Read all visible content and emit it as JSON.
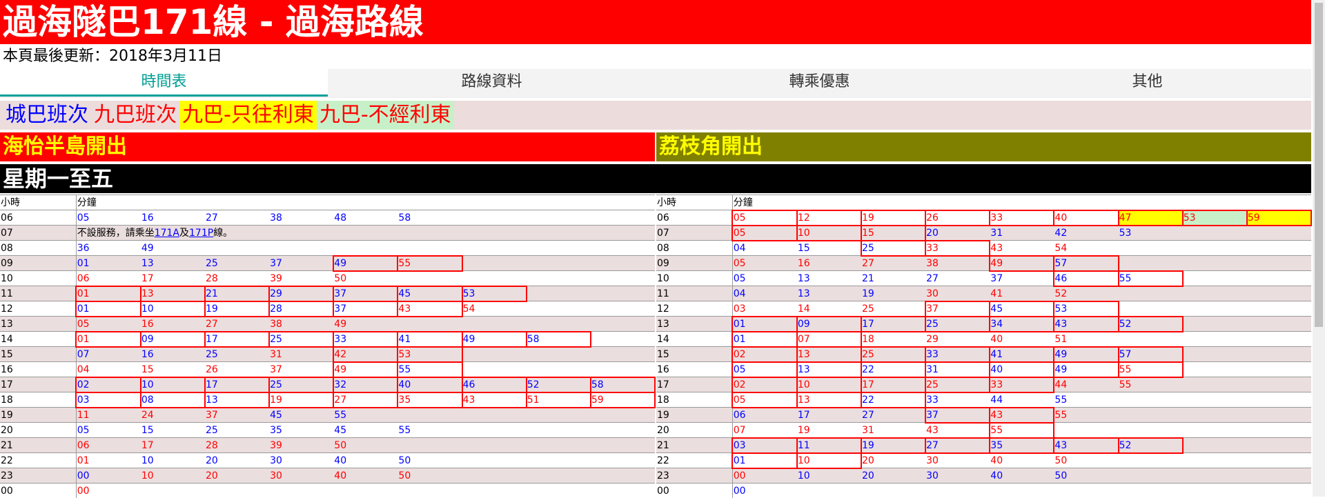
{
  "title": "過海隧巴171線 - 過海路線",
  "updated": "本頁最後更新：2018年3月11日",
  "tabs": [
    {
      "label": "時間表",
      "active": true
    },
    {
      "label": "路線資料",
      "active": false
    },
    {
      "label": "轉乘優惠",
      "active": false
    },
    {
      "label": "其他",
      "active": false
    }
  ],
  "legend": [
    {
      "label": "城巴班次",
      "color": "#0000ff",
      "bg": "#ecdcdc"
    },
    {
      "label": "九巴班次",
      "color": "#ff0000",
      "bg": "#ecdcdc"
    },
    {
      "label": "九巴-只往利東",
      "color": "#ff0000",
      "bg": "#ffff00"
    },
    {
      "label": "九巴-不經利東",
      "color": "#ff0000",
      "bg": "#c8f0c8"
    }
  ],
  "directions": {
    "left": "海怡半島開出",
    "right": "荔枝角開出"
  },
  "day_label": "星期一至五",
  "col_headers": {
    "hour": "小時",
    "minute": "分鐘"
  },
  "left_table": [
    {
      "h": "06",
      "m": [
        [
          "05",
          "c"
        ],
        [
          "16",
          "c"
        ],
        [
          "27",
          "c"
        ],
        [
          "38",
          "c"
        ],
        [
          "48",
          "c"
        ],
        [
          "58",
          "c"
        ]
      ]
    },
    {
      "h": "07",
      "note": {
        "pre": "不設服務，請乘坐",
        "link1": "171A",
        "mid": "及",
        "link2": "171P",
        "post": "線。"
      }
    },
    {
      "h": "08",
      "m": [
        [
          "36",
          "c"
        ],
        [
          "49",
          "c"
        ]
      ]
    },
    {
      "h": "09",
      "m": [
        [
          "01",
          "c"
        ],
        [
          "13",
          "c"
        ],
        [
          "25",
          "c"
        ],
        [
          "37",
          "c"
        ],
        [
          "49",
          "c",
          "box"
        ],
        [
          "55",
          "k",
          "box"
        ]
      ]
    },
    {
      "h": "10",
      "m": [
        [
          "06",
          "k"
        ],
        [
          "17",
          "k"
        ],
        [
          "28",
          "k"
        ],
        [
          "39",
          "k"
        ],
        [
          "50",
          "k"
        ]
      ]
    },
    {
      "h": "11",
      "m": [
        [
          "01",
          "k",
          "box"
        ],
        [
          "13",
          "k",
          "box"
        ],
        [
          "21",
          "c",
          "box"
        ],
        [
          "29",
          "c",
          "box"
        ],
        [
          "37",
          "c",
          "box"
        ],
        [
          "45",
          "c",
          "box"
        ],
        [
          "53",
          "c",
          "box"
        ]
      ]
    },
    {
      "h": "12",
      "m": [
        [
          "01",
          "c",
          "box"
        ],
        [
          "10",
          "c",
          "box"
        ],
        [
          "19",
          "c",
          "box"
        ],
        [
          "28",
          "c",
          "box"
        ],
        [
          "37",
          "c",
          "box"
        ],
        [
          "43",
          "k",
          "box"
        ],
        [
          "54",
          "k"
        ]
      ]
    },
    {
      "h": "13",
      "m": [
        [
          "05",
          "k"
        ],
        [
          "16",
          "k"
        ],
        [
          "27",
          "k"
        ],
        [
          "38",
          "k"
        ],
        [
          "49",
          "k"
        ]
      ]
    },
    {
      "h": "14",
      "m": [
        [
          "01",
          "k",
          "box"
        ],
        [
          "09",
          "c",
          "box"
        ],
        [
          "17",
          "c",
          "box"
        ],
        [
          "25",
          "c",
          "box"
        ],
        [
          "33",
          "c",
          "box"
        ],
        [
          "41",
          "c",
          "box"
        ],
        [
          "49",
          "c",
          "box"
        ],
        [
          "58",
          "c",
          "box"
        ]
      ]
    },
    {
      "h": "15",
      "m": [
        [
          "07",
          "c"
        ],
        [
          "16",
          "c"
        ],
        [
          "25",
          "c"
        ],
        [
          "31",
          "k"
        ],
        [
          "42",
          "k",
          "box"
        ],
        [
          "53",
          "k",
          "box"
        ]
      ]
    },
    {
      "h": "16",
      "m": [
        [
          "04",
          "k"
        ],
        [
          "15",
          "k"
        ],
        [
          "26",
          "k"
        ],
        [
          "37",
          "k"
        ],
        [
          "49",
          "k",
          "box"
        ],
        [
          "55",
          "c",
          "box"
        ]
      ]
    },
    {
      "h": "17",
      "m": [
        [
          "02",
          "c",
          "box"
        ],
        [
          "10",
          "c",
          "box"
        ],
        [
          "17",
          "c",
          "box"
        ],
        [
          "25",
          "c",
          "box"
        ],
        [
          "32",
          "c",
          "box"
        ],
        [
          "40",
          "c",
          "box"
        ],
        [
          "46",
          "c",
          "box"
        ],
        [
          "52",
          "c",
          "box"
        ],
        [
          "58",
          "c",
          "box"
        ]
      ]
    },
    {
      "h": "18",
      "m": [
        [
          "03",
          "c",
          "box"
        ],
        [
          "08",
          "c",
          "box"
        ],
        [
          "13",
          "c",
          "box"
        ],
        [
          "19",
          "k",
          "box"
        ],
        [
          "27",
          "k",
          "box"
        ],
        [
          "35",
          "k",
          "box"
        ],
        [
          "43",
          "k",
          "box"
        ],
        [
          "51",
          "k",
          "box"
        ],
        [
          "59",
          "k",
          "box"
        ]
      ]
    },
    {
      "h": "19",
      "m": [
        [
          "11",
          "k"
        ],
        [
          "24",
          "k"
        ],
        [
          "37",
          "k"
        ],
        [
          "45",
          "c"
        ],
        [
          "55",
          "c"
        ]
      ]
    },
    {
      "h": "20",
      "m": [
        [
          "05",
          "c"
        ],
        [
          "15",
          "c"
        ],
        [
          "25",
          "c"
        ],
        [
          "35",
          "c"
        ],
        [
          "45",
          "c"
        ],
        [
          "55",
          "c"
        ]
      ]
    },
    {
      "h": "21",
      "m": [
        [
          "06",
          "k"
        ],
        [
          "17",
          "k"
        ],
        [
          "28",
          "k"
        ],
        [
          "39",
          "k"
        ],
        [
          "50",
          "k"
        ]
      ]
    },
    {
      "h": "22",
      "m": [
        [
          "01",
          "k"
        ],
        [
          "10",
          "c"
        ],
        [
          "20",
          "c"
        ],
        [
          "30",
          "c"
        ],
        [
          "40",
          "c"
        ],
        [
          "50",
          "c"
        ]
      ]
    },
    {
      "h": "23",
      "m": [
        [
          "00",
          "c"
        ],
        [
          "10",
          "k"
        ],
        [
          "20",
          "k"
        ],
        [
          "30",
          "k"
        ],
        [
          "40",
          "k"
        ],
        [
          "50",
          "k"
        ]
      ]
    },
    {
      "h": "00",
      "m": [
        [
          "00",
          "k"
        ]
      ]
    }
  ],
  "right_table": [
    {
      "h": "06",
      "m": [
        [
          "05",
          "k",
          "box"
        ],
        [
          "12",
          "k",
          "box"
        ],
        [
          "19",
          "k",
          "box"
        ],
        [
          "26",
          "k",
          "box"
        ],
        [
          "33",
          "k",
          "box"
        ],
        [
          "40",
          "k",
          "box"
        ],
        [
          "47",
          "k",
          "hl-y box"
        ],
        [
          "53",
          "k",
          "hl-g box"
        ],
        [
          "59",
          "k",
          "hl-y box"
        ]
      ]
    },
    {
      "h": "07",
      "m": [
        [
          "05",
          "k",
          "hl-g box"
        ],
        [
          "10",
          "k",
          "hl-y box"
        ],
        [
          "15",
          "k",
          "hl-g box"
        ],
        [
          "20",
          "c"
        ],
        [
          "31",
          "c"
        ],
        [
          "42",
          "c"
        ],
        [
          "53",
          "c"
        ]
      ]
    },
    {
      "h": "08",
      "m": [
        [
          "04",
          "c"
        ],
        [
          "15",
          "c"
        ],
        [
          "25",
          "c",
          "box"
        ],
        [
          "33",
          "k",
          "box"
        ],
        [
          "43",
          "k"
        ],
        [
          "54",
          "k"
        ]
      ]
    },
    {
      "h": "09",
      "m": [
        [
          "05",
          "k"
        ],
        [
          "16",
          "k"
        ],
        [
          "27",
          "k"
        ],
        [
          "38",
          "k"
        ],
        [
          "49",
          "k",
          "box"
        ],
        [
          "57",
          "c",
          "box"
        ]
      ]
    },
    {
      "h": "10",
      "m": [
        [
          "05",
          "c"
        ],
        [
          "13",
          "c"
        ],
        [
          "21",
          "c"
        ],
        [
          "27",
          "c"
        ],
        [
          "37",
          "c"
        ],
        [
          "46",
          "c",
          "box"
        ],
        [
          "55",
          "c",
          "box"
        ]
      ]
    },
    {
      "h": "11",
      "m": [
        [
          "04",
          "c"
        ],
        [
          "13",
          "c"
        ],
        [
          "19",
          "c"
        ],
        [
          "30",
          "k"
        ],
        [
          "41",
          "k"
        ],
        [
          "52",
          "k"
        ]
      ]
    },
    {
      "h": "12",
      "m": [
        [
          "03",
          "k"
        ],
        [
          "14",
          "k"
        ],
        [
          "25",
          "k"
        ],
        [
          "37",
          "k",
          "box"
        ],
        [
          "45",
          "c",
          "box"
        ],
        [
          "53",
          "c",
          "box"
        ]
      ]
    },
    {
      "h": "13",
      "m": [
        [
          "01",
          "c",
          "box"
        ],
        [
          "09",
          "c",
          "box"
        ],
        [
          "17",
          "c",
          "box"
        ],
        [
          "25",
          "c",
          "box"
        ],
        [
          "34",
          "c",
          "box"
        ],
        [
          "43",
          "c",
          "box"
        ],
        [
          "52",
          "c",
          "box"
        ]
      ]
    },
    {
      "h": "14",
      "m": [
        [
          "01",
          "c",
          "box"
        ],
        [
          "07",
          "k",
          "box"
        ],
        [
          "18",
          "k"
        ],
        [
          "29",
          "k"
        ],
        [
          "40",
          "k"
        ],
        [
          "51",
          "k"
        ]
      ]
    },
    {
      "h": "15",
      "m": [
        [
          "02",
          "k",
          "box"
        ],
        [
          "13",
          "k",
          "box"
        ],
        [
          "25",
          "k",
          "box"
        ],
        [
          "33",
          "c",
          "box"
        ],
        [
          "41",
          "c",
          "box"
        ],
        [
          "49",
          "c",
          "box"
        ],
        [
          "57",
          "c",
          "box"
        ]
      ]
    },
    {
      "h": "16",
      "m": [
        [
          "05",
          "c",
          "box"
        ],
        [
          "13",
          "c",
          "box"
        ],
        [
          "22",
          "c",
          "box"
        ],
        [
          "31",
          "c",
          "box"
        ],
        [
          "40",
          "c",
          "box"
        ],
        [
          "49",
          "c",
          "box"
        ],
        [
          "55",
          "k",
          "box"
        ]
      ]
    },
    {
      "h": "17",
      "m": [
        [
          "02",
          "k",
          "box"
        ],
        [
          "10",
          "k",
          "box"
        ],
        [
          "17",
          "k",
          "box"
        ],
        [
          "25",
          "k",
          "box"
        ],
        [
          "33",
          "k",
          "box"
        ],
        [
          "44",
          "k"
        ],
        [
          "55",
          "k"
        ]
      ]
    },
    {
      "h": "18",
      "m": [
        [
          "05",
          "k",
          "box"
        ],
        [
          "13",
          "k",
          "box"
        ],
        [
          "22",
          "c",
          "box"
        ],
        [
          "33",
          "c"
        ],
        [
          "44",
          "c"
        ],
        [
          "55",
          "c"
        ]
      ]
    },
    {
      "h": "19",
      "m": [
        [
          "06",
          "c"
        ],
        [
          "17",
          "c"
        ],
        [
          "27",
          "c"
        ],
        [
          "37",
          "c",
          "box"
        ],
        [
          "43",
          "k",
          "box"
        ],
        [
          "55",
          "k"
        ]
      ]
    },
    {
      "h": "20",
      "m": [
        [
          "07",
          "k"
        ],
        [
          "19",
          "k"
        ],
        [
          "31",
          "k"
        ],
        [
          "43",
          "k"
        ],
        [
          "55",
          "k",
          "box"
        ]
      ]
    },
    {
      "h": "21",
      "m": [
        [
          "03",
          "c",
          "box"
        ],
        [
          "11",
          "c",
          "box"
        ],
        [
          "19",
          "c",
          "box"
        ],
        [
          "27",
          "c",
          "box"
        ],
        [
          "35",
          "c",
          "box"
        ],
        [
          "43",
          "c",
          "box"
        ],
        [
          "52",
          "c",
          "box"
        ]
      ]
    },
    {
      "h": "22",
      "m": [
        [
          "01",
          "c",
          "box"
        ],
        [
          "10",
          "k",
          "box"
        ],
        [
          "20",
          "k"
        ],
        [
          "30",
          "k"
        ],
        [
          "40",
          "k"
        ],
        [
          "50",
          "k"
        ]
      ]
    },
    {
      "h": "23",
      "m": [
        [
          "00",
          "k"
        ],
        [
          "10",
          "c"
        ],
        [
          "20",
          "c"
        ],
        [
          "30",
          "c"
        ],
        [
          "40",
          "c"
        ],
        [
          "50",
          "c"
        ]
      ]
    },
    {
      "h": "00",
      "m": [
        [
          "00",
          "c"
        ]
      ]
    }
  ]
}
